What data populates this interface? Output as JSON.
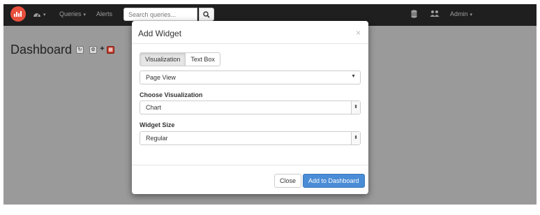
{
  "navbar": {
    "menu_queries": "Queries",
    "menu_alerts": "Alerts",
    "search_placeholder": "Search queries...",
    "user_name": "Admin"
  },
  "dashboard": {
    "title": "Dashboard"
  },
  "modal": {
    "title": "Add Widget",
    "close_glyph": "×",
    "tabs": [
      {
        "label": "Visualization",
        "active": true
      },
      {
        "label": "Text Box",
        "active": false
      }
    ],
    "query_select_value": "Page View",
    "visualization_label": "Choose Visualization",
    "visualization_value": "Chart",
    "size_label": "Widget Size",
    "size_value": "Regular",
    "close_button": "Close",
    "add_button": "Add to Dashboard"
  },
  "colors": {
    "navbar_bg": "#1f1f1f",
    "brand_red": "#e8503e",
    "primary_button": "#4a8cd6"
  }
}
